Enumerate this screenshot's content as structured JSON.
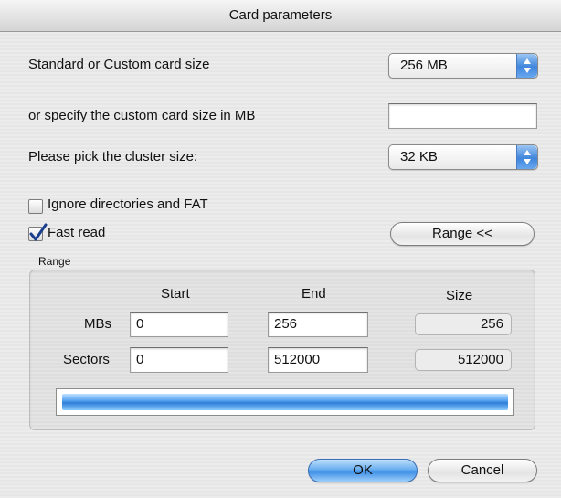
{
  "window": {
    "title": "Card parameters"
  },
  "card_size": {
    "label": "Standard or Custom card size",
    "selected": "256 MB"
  },
  "custom_size": {
    "label": "or specify the custom card size in MB",
    "value": ""
  },
  "cluster_size": {
    "label": "Please pick the cluster size:",
    "selected": "32 KB"
  },
  "ignore_dirs": {
    "label": "Ignore directories and FAT",
    "checked": false
  },
  "fast_read": {
    "label": "Fast read",
    "checked": true
  },
  "range_button": {
    "label": "Range <<"
  },
  "range": {
    "group_label": "Range",
    "headers": {
      "start": "Start",
      "end": "End",
      "size": "Size"
    },
    "mbs": {
      "label": "MBs",
      "start": "0",
      "end": "256",
      "size": "256"
    },
    "sectors": {
      "label": "Sectors",
      "start": "0",
      "end": "512000",
      "size": "512000"
    },
    "progress": 1.0
  },
  "buttons": {
    "ok": "OK",
    "cancel": "Cancel"
  },
  "colors": {
    "accent": "#3b8ee6",
    "checkmark": "#1a3f8f"
  },
  "icons": {
    "popup_arrows": "updown-arrows-icon",
    "checkmark": "checkmark-icon"
  }
}
